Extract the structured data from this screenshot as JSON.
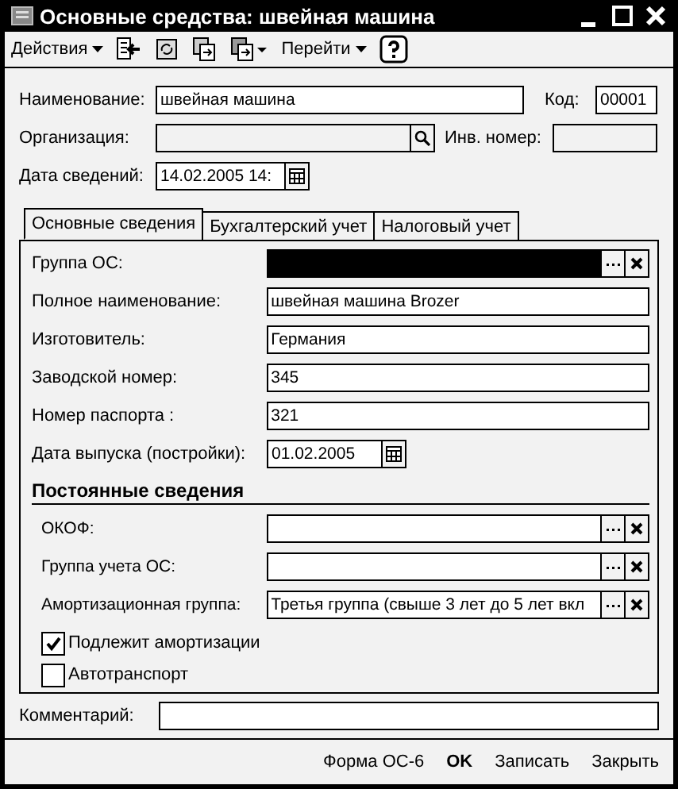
{
  "window": {
    "title": "Основные средства: швейная машина"
  },
  "toolbar": {
    "actions_menu": "Действия",
    "goto_menu": "Перейти"
  },
  "header": {
    "name": {
      "label": "Наименование:",
      "value": "швейная машина"
    },
    "code": {
      "label": "Код:",
      "value": "00001"
    },
    "organization": {
      "label": "Организация:"
    },
    "inventory_number": {
      "label": "Инв. номер:"
    },
    "date": {
      "label": "Дата сведений:",
      "value": "14.02.2005 14:"
    }
  },
  "tabs": [
    {
      "label": "Основные сведения",
      "selected": true
    },
    {
      "label": "Бухгалтерский учет",
      "selected": false
    },
    {
      "label": "Налоговый учет",
      "selected": false
    }
  ],
  "fields": [
    {
      "kind": "picker",
      "label": "Группа ОС:",
      "highlighted": true
    },
    {
      "kind": "text",
      "label": "Полное наименование:",
      "value": "швейная машина Brozer"
    },
    {
      "kind": "text",
      "label": "Изготовитель:",
      "value": "Германия"
    },
    {
      "kind": "text",
      "label": "Заводской номер:",
      "value": "345"
    },
    {
      "kind": "text",
      "label": "Номер паспорта :",
      "value": "321"
    },
    {
      "kind": "date",
      "label": "Дата выпуска (постройки):",
      "value": "01.02.2005"
    }
  ],
  "section": {
    "title": "Постоянные сведения"
  },
  "constant_fields": [
    {
      "kind": "picker",
      "label": "ОКОФ:"
    },
    {
      "kind": "picker",
      "label": "Группа учета ОС:"
    },
    {
      "kind": "picker",
      "label": "Амортизационная группа:",
      "value": "Третья группа (свыше 3 лет до 5 лет вкл"
    }
  ],
  "checkboxes": [
    {
      "label": "Подлежит амортизации",
      "checked": true
    },
    {
      "label": "Автотранспорт",
      "checked": false
    }
  ],
  "comment": {
    "label": "Комментарий:"
  },
  "buttons": [
    {
      "label": "Форма ОС-6",
      "default": false
    },
    {
      "label": "OK",
      "default": true
    },
    {
      "label": "Записать",
      "default": false
    },
    {
      "label": "Закрыть",
      "default": false
    }
  ]
}
